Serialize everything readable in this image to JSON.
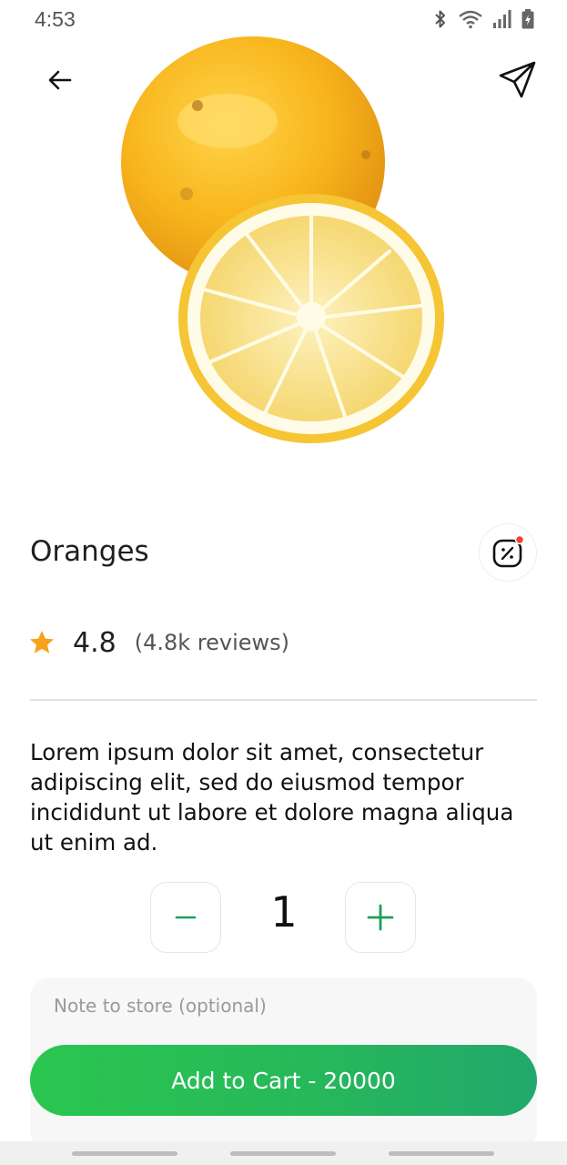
{
  "status_bar": {
    "time": "4:53",
    "icons": [
      "bluetooth-icon",
      "wifi-icon",
      "signal-icon",
      "battery-icon"
    ]
  },
  "header": {
    "back_icon": "arrow-left-icon",
    "share_icon": "send-icon"
  },
  "product": {
    "image": "lemon-image",
    "name": "Oranges",
    "rating": "4.8",
    "reviews": "(4.8k reviews)",
    "description": "Lorem ipsum dolor sit amet, consectetur adipiscing elit, sed do eiusmod tempor incididunt ut labore et dolore magna aliqua ut enim ad."
  },
  "quantity": {
    "value": "1",
    "minus_icon": "minus-icon",
    "plus_icon": "plus-icon"
  },
  "note": {
    "placeholder": "Note to store (optional)",
    "value": ""
  },
  "cart": {
    "label": "Add to Cart - 20000"
  },
  "colors": {
    "accent": "#2ac650",
    "star": "#f7a21b",
    "badge_dot": "#f44336"
  }
}
